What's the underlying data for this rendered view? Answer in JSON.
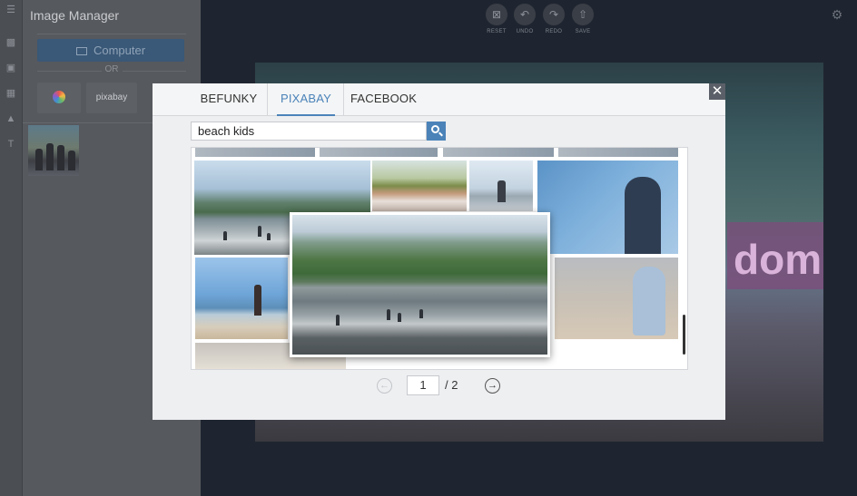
{
  "sidebar": {
    "title": "Image Manager",
    "computer_label": "Computer",
    "or_label": "OR",
    "sources": [
      {
        "name": "befunky",
        "icon": "befunky-logo-icon"
      },
      {
        "name": "pixabay",
        "label": "pixabay"
      }
    ]
  },
  "toolbar": {
    "items": [
      {
        "label": "RESET",
        "icon": "reset-icon"
      },
      {
        "label": "UNDO",
        "icon": "undo-icon"
      },
      {
        "label": "REDO",
        "icon": "redo-icon"
      },
      {
        "label": "SAVE",
        "icon": "save-icon"
      }
    ],
    "settings_icon": "gear-icon"
  },
  "canvas": {
    "overlay_text": "dom",
    "overlay_color": "#7a4e7a"
  },
  "modal": {
    "tabs": [
      {
        "label": "BEFUNKY",
        "active": false
      },
      {
        "label": "PIXABAY",
        "active": true
      },
      {
        "label": "FACEBOOK",
        "active": false
      }
    ],
    "search": {
      "value": "beach kids",
      "button_icon": "search-icon"
    },
    "pagination": {
      "current_page": "1",
      "total_label": "/ 2",
      "prev_icon": "arrow-left-icon",
      "next_icon": "arrow-right-icon"
    },
    "close_icon": "close-icon",
    "accent_color": "#4b83b9"
  }
}
